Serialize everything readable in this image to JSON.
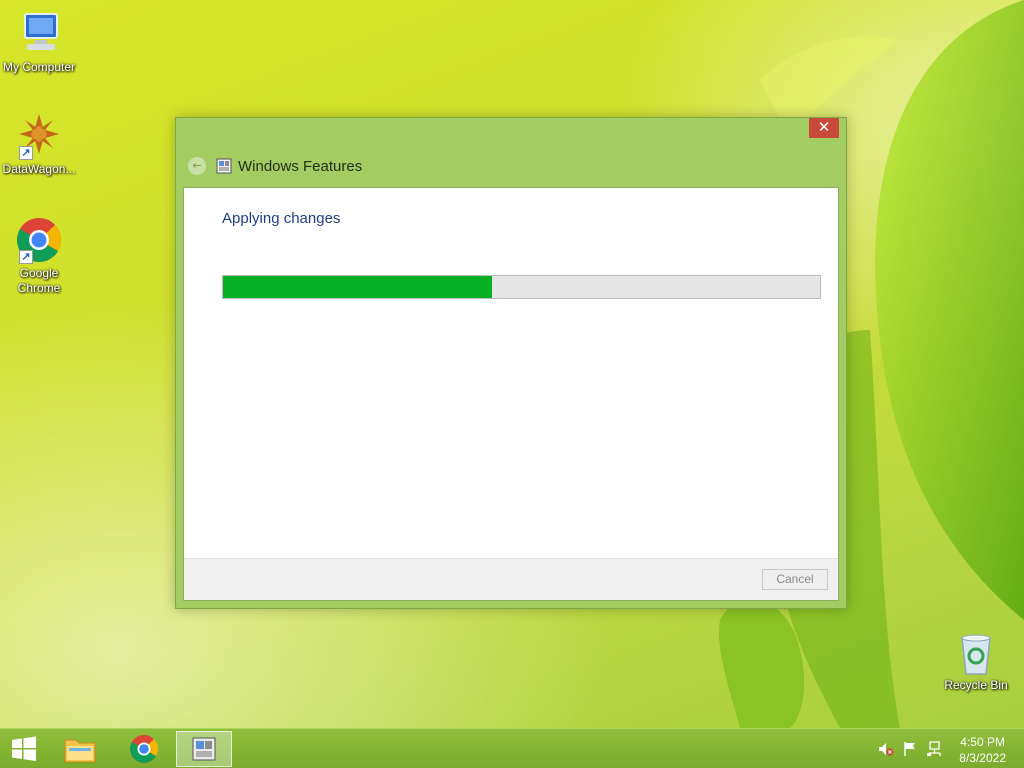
{
  "desktop": {
    "icons": [
      {
        "label": "My Computer"
      },
      {
        "label": "DataWagon..."
      },
      {
        "label": "Google Chrome"
      },
      {
        "label": "Recycle Bin"
      }
    ]
  },
  "window": {
    "title": "Windows Features",
    "close_glyph": "✕",
    "back_glyph": "←",
    "heading": "Applying changes",
    "progress_percent": 45,
    "cancel_label": "Cancel"
  },
  "taskbar": {
    "items": [
      "start-button",
      "file-explorer",
      "google-chrome",
      "windows-features"
    ],
    "clock": {
      "time": "4:50 PM",
      "date": "8/3/2022"
    }
  },
  "colors": {
    "accent": "#a3cc63",
    "progress": "#06b025",
    "close": "#c74a3b"
  }
}
